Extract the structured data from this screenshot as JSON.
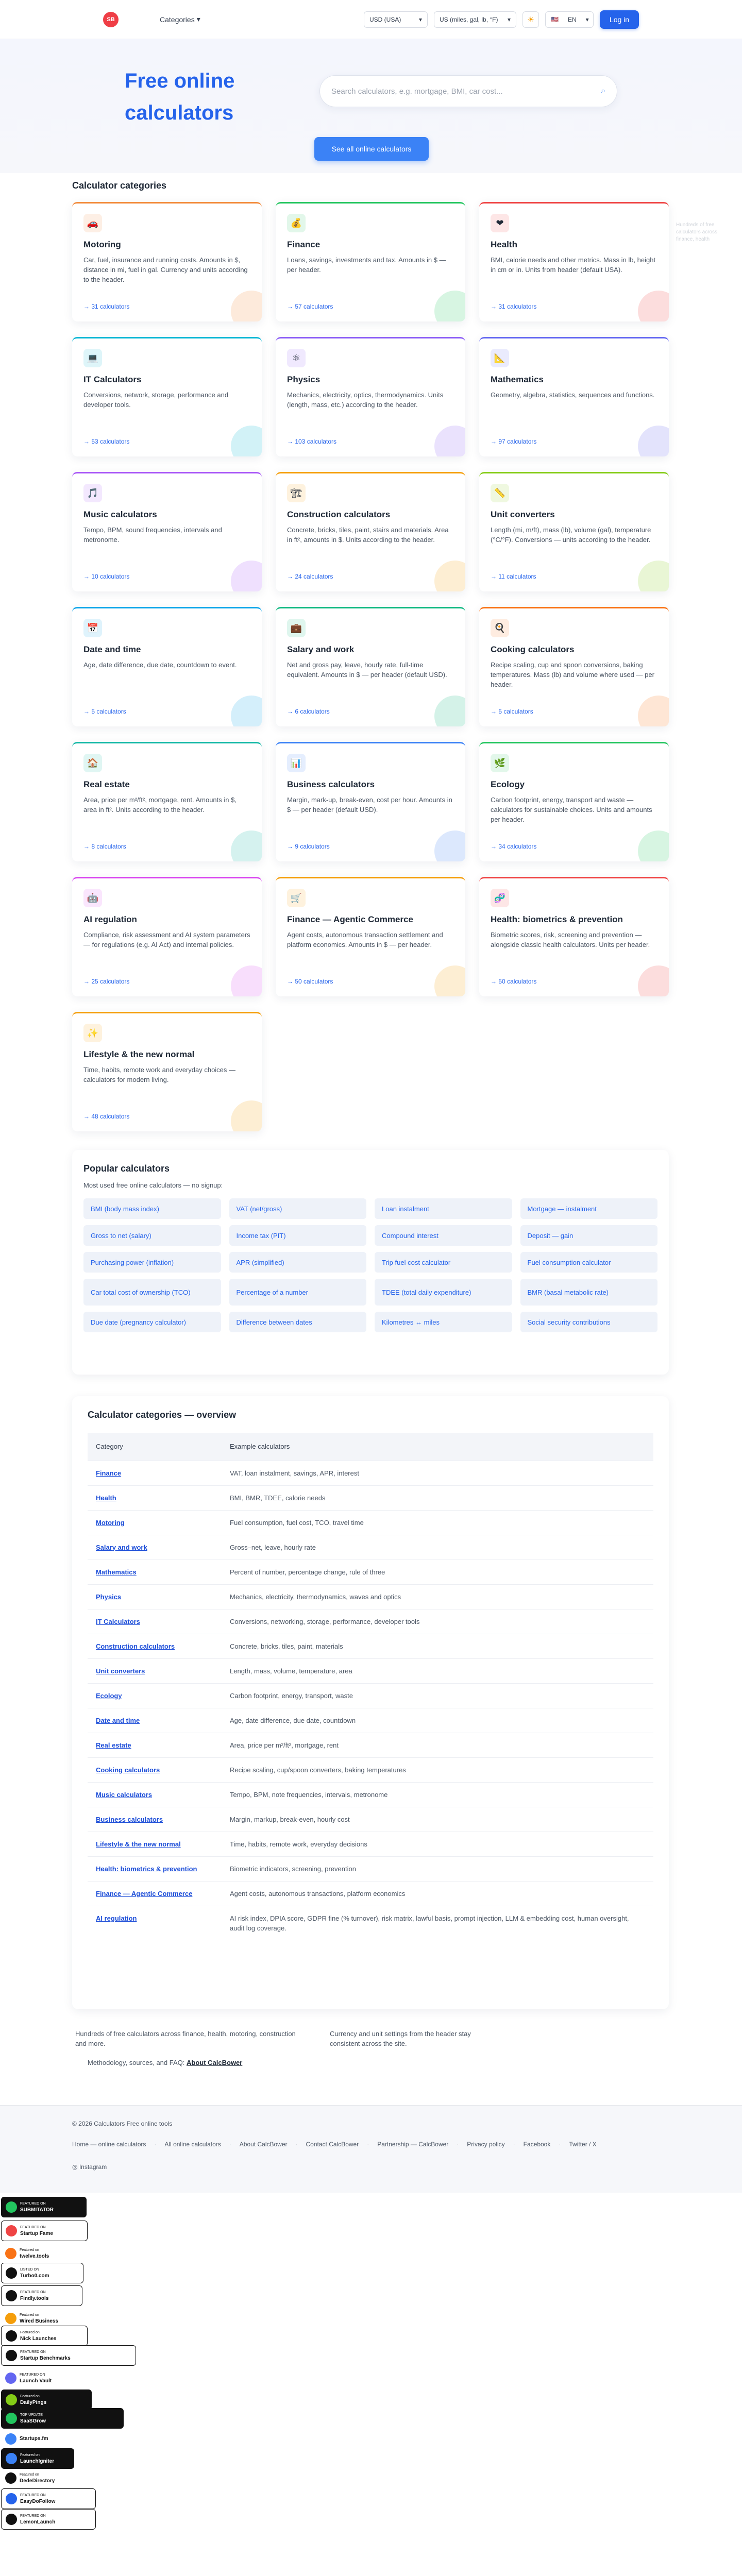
{
  "header": {
    "logo_text": "SB",
    "categories_menu": "Categories",
    "currency": "USD (USA)",
    "units": "US (miles, gal, lb, °F)",
    "language": "EN",
    "language_flag": "🇺🇸",
    "login": "Log in"
  },
  "hero": {
    "title": "Free online calculators",
    "search_placeholder": "Search calculators, e.g. mortgage, BMI, car cost...",
    "see_all": "See all online calculators"
  },
  "categories_title": "Calculator categories",
  "categories": [
    {
      "name": "Motoring",
      "icon": "car-icon",
      "glyph": "🚗",
      "color": "#f28a3a",
      "desc": "Car, fuel, insurance and running costs. Amounts in $, distance in mi, fuel in gal. Currency and units according to the header.",
      "count": "→ 31 calculators"
    },
    {
      "name": "Finance",
      "icon": "money-bag-icon",
      "glyph": "💰",
      "color": "#22c55e",
      "desc": "Loans, savings, investments and tax. Amounts in $ — per header.",
      "count": "→ 57 calculators"
    },
    {
      "name": "Health",
      "icon": "heart-icon",
      "glyph": "❤",
      "color": "#ef4444",
      "desc": "BMI, calorie needs and other metrics. Mass in lb, height in cm or in. Units from header (default USA).",
      "count": "→ 31 calculators"
    },
    {
      "name": "IT Calculators",
      "icon": "laptop-icon",
      "glyph": "💻",
      "color": "#06b6d4",
      "desc": "Conversions, network, storage, performance and developer tools.",
      "count": "→ 53 calculators"
    },
    {
      "name": "Physics",
      "icon": "atom-icon",
      "glyph": "⚛",
      "color": "#8b5cf6",
      "desc": "Mechanics, electricity, optics, thermodynamics. Units (length, mass, etc.) according to the header.",
      "count": "→ 103 calculators"
    },
    {
      "name": "Mathematics",
      "icon": "ruler-icon",
      "glyph": "📐",
      "color": "#6366f1",
      "desc": "Geometry, algebra, statistics, sequences and functions.",
      "count": "→ 97 calculators"
    },
    {
      "name": "Music calculators",
      "icon": "music-note-icon",
      "glyph": "🎵",
      "color": "#a855f7",
      "desc": "Tempo, BPM, sound frequencies, intervals and metronome.",
      "count": "→ 10 calculators"
    },
    {
      "name": "Construction calculators",
      "icon": "building-icon",
      "glyph": "🏗",
      "color": "#f59e0b",
      "desc": "Concrete, bricks, tiles, paint, stairs and materials. Area in ft², amounts in $. Units according to the header.",
      "count": "→ 24 calculators"
    },
    {
      "name": "Unit converters",
      "icon": "ruler-straight-icon",
      "glyph": "📏",
      "color": "#84cc16",
      "desc": "Length (mi, m/ft), mass (lb), volume (gal), temperature (°C/°F). Conversions — units according to the header.",
      "count": "→ 11 calculators"
    },
    {
      "name": "Date and time",
      "icon": "calendar-icon",
      "glyph": "📅",
      "color": "#0ea5e9",
      "desc": "Age, date difference, due date, countdown to event.",
      "count": "→ 5 calculators"
    },
    {
      "name": "Salary and work",
      "icon": "briefcase-icon",
      "glyph": "💼",
      "color": "#10b981",
      "desc": "Net and gross pay, leave, hourly rate, full-time equivalent. Amounts in $ — per header (default USD).",
      "count": "→ 6 calculators"
    },
    {
      "name": "Cooking calculators",
      "icon": "cooking-icon",
      "glyph": "🍳",
      "color": "#f97316",
      "desc": "Recipe scaling, cup and spoon conversions, baking temperatures. Mass (lb) and volume where used — per header.",
      "count": "→ 5 calculators"
    },
    {
      "name": "Real estate",
      "icon": "house-icon",
      "glyph": "🏠",
      "color": "#14b8a6",
      "desc": "Area, price per m²/ft², mortgage, rent. Amounts in $, area in ft². Units according to the header.",
      "count": "→ 8 calculators"
    },
    {
      "name": "Business calculators",
      "icon": "chart-icon",
      "glyph": "📊",
      "color": "#3b82f6",
      "desc": "Margin, mark-up, break-even, cost per hour. Amounts in $ — per header (default USD).",
      "count": "→ 9 calculators"
    },
    {
      "name": "Ecology",
      "icon": "leaf-icon",
      "glyph": "🌿",
      "color": "#22c55e",
      "desc": "Carbon footprint, energy, transport and waste — calculators for sustainable choices. Units and amounts per header.",
      "count": "→ 34 calculators"
    },
    {
      "name": "AI regulation",
      "icon": "robot-icon",
      "glyph": "🤖",
      "color": "#d946ef",
      "desc": "Compliance, risk assessment and AI system parameters — for regulations (e.g. AI Act) and internal policies.",
      "count": "→ 25 calculators"
    },
    {
      "name": "Finance — Agentic Commerce",
      "icon": "shopping-cart-icon",
      "glyph": "🛒",
      "color": "#f59e0b",
      "desc": "Agent costs, autonomous transaction settlement and platform economics. Amounts in $ — per header.",
      "count": "→ 50 calculators"
    },
    {
      "name": "Health: biometrics & prevention",
      "icon": "dna-icon",
      "glyph": "🧬",
      "color": "#ef4444",
      "desc": "Biometric scores, risk, screening and prevention — alongside classic health calculators. Units per header.",
      "count": "→ 50 calculators"
    },
    {
      "name": "Lifestyle & the new normal",
      "icon": "sparkle-icon",
      "glyph": "✨",
      "color": "#f59e0b",
      "desc": "Time, habits, remote work and everyday choices — calculators for modern living.",
      "count": "→ 48 calculators"
    }
  ],
  "ghost_text": "Hundreds of free calculators across finance, health",
  "popular": {
    "title": "Popular calculators",
    "subtitle": "Most used free online calculators — no signup:",
    "items": [
      "BMI (body mass index)",
      "VAT (net/gross)",
      "Loan instalment",
      "Mortgage — instalment",
      "Gross to net (salary)",
      "Income tax (PIT)",
      "Compound interest",
      "Deposit — gain",
      "Purchasing power (inflation)",
      "APR (simplified)",
      "Trip fuel cost calculator",
      "Fuel consumption calculator",
      "Car total cost of ownership (TCO)",
      "Percentage of a number",
      "TDEE (total daily expenditure)",
      "BMR (basal metabolic rate)",
      "Due date (pregnancy calculator)",
      "Difference between dates",
      "Kilometres ↔ miles",
      "Social security contributions"
    ]
  },
  "overview": {
    "title": "Calculator categories — overview",
    "col_category": "Category",
    "col_examples": "Example calculators",
    "rows": [
      {
        "cat": "Finance",
        "ex": "VAT, loan instalment, savings, APR, interest"
      },
      {
        "cat": "Health",
        "ex": "BMI, BMR, TDEE, calorie needs"
      },
      {
        "cat": "Motoring",
        "ex": "Fuel consumption, fuel cost, TCO, travel time"
      },
      {
        "cat": "Salary and work",
        "ex": "Gross–net, leave, hourly rate"
      },
      {
        "cat": "Mathematics",
        "ex": "Percent of number, percentage change, rule of three"
      },
      {
        "cat": "Physics",
        "ex": "Mechanics, electricity, thermodynamics, waves and optics"
      },
      {
        "cat": "IT Calculators",
        "ex": "Conversions, networking, storage, performance, developer tools"
      },
      {
        "cat": "Construction calculators",
        "ex": "Concrete, bricks, tiles, paint, materials"
      },
      {
        "cat": "Unit converters",
        "ex": "Length, mass, volume, temperature, area"
      },
      {
        "cat": "Ecology",
        "ex": "Carbon footprint, energy, transport, waste"
      },
      {
        "cat": "Date and time",
        "ex": "Age, date difference, due date, countdown"
      },
      {
        "cat": "Real estate",
        "ex": "Area, price per m²/ft², mortgage, rent"
      },
      {
        "cat": "Cooking calculators",
        "ex": "Recipe scaling, cup/spoon converters, baking temperatures"
      },
      {
        "cat": "Music calculators",
        "ex": "Tempo, BPM, note frequencies, intervals, metronome"
      },
      {
        "cat": "Business calculators",
        "ex": "Margin, markup, break-even, hourly cost"
      },
      {
        "cat": "Lifestyle & the new normal",
        "ex": "Time, habits, remote work, everyday decisions"
      },
      {
        "cat": "Health: biometrics & prevention",
        "ex": "Biometric indicators, screening, prevention"
      },
      {
        "cat": "Finance — Agentic Commerce",
        "ex": "Agent costs, autonomous transactions, platform economics"
      },
      {
        "cat": "AI regulation",
        "ex": "AI risk index, DPIA score, GDPR fine (% turnover), risk matrix, lawful basis, prompt injection, LLM & embedding cost, human oversight, audit log coverage."
      }
    ]
  },
  "notes": {
    "left": "Hundreds of free calculators across finance, health, motoring, construction and more.",
    "right": "Currency and unit settings from the header stay consistent across the site.",
    "methodology_prefix": "Methodology, sources, and FAQ:",
    "methodology_link": "About CalcBower"
  },
  "footer": {
    "copyright": "© 2026 Calculators Free online tools",
    "links": [
      "Home — online calculators",
      "All online calculators",
      "About CalcBower",
      "Contact CalcBower",
      "Partnership — CalcBower",
      "Privacy policy",
      "Facebook",
      "Twitter / X"
    ],
    "instagram": "Instagram"
  },
  "badges": [
    {
      "top": "FEATURED ON",
      "name": "SUBMITATOR",
      "style": "dark",
      "icon": "submitator-icon",
      "color": "#22c55e"
    },
    {
      "top": "FEATURED ON",
      "name": "Startup Fame",
      "style": "light",
      "icon": "startup-fame-icon",
      "color": "#ef4444"
    },
    {
      "top": "Featured on",
      "name": "twelve.tools",
      "style": "plain",
      "icon": "twelve-tools-icon",
      "color": "#f97316"
    },
    {
      "top": "LISTED ON",
      "name": "Turbo0.com",
      "style": "light",
      "icon": "turbo0-icon",
      "color": "#111111"
    },
    {
      "top": "FEATURED ON",
      "name": "Findly.tools",
      "style": "light",
      "icon": "findly-icon",
      "color": "#111111"
    },
    {
      "top": "Featured on",
      "name": "Wired Business",
      "style": "plain",
      "icon": "wired-business-icon",
      "color": "#f59e0b"
    },
    {
      "top": "Featured on",
      "name": "Nick Launches",
      "style": "light",
      "icon": "nick-launches-icon",
      "color": "#111111"
    },
    {
      "top": "FEATURED ON",
      "name": "Startup Benchmarks",
      "style": "light",
      "icon": "startup-benchmarks-icon",
      "color": "#111111"
    },
    {
      "top": "FEATURED ON",
      "name": "Launch Vault",
      "style": "plain",
      "icon": "launch-vault-icon",
      "color": "#6366f1"
    },
    {
      "top": "Featured on",
      "name": "DailyPings",
      "style": "dark",
      "icon": "dailypings-icon",
      "color": "#84cc16"
    },
    {
      "top": "TOP UPDATE",
      "name": "SaaSGrow",
      "style": "dark",
      "icon": "saasgrow-icon",
      "color": "#22c55e"
    },
    {
      "top": "",
      "name": "Startups.fm",
      "style": "plain",
      "icon": "startups-fm-icon",
      "color": "#3b82f6"
    },
    {
      "top": "Featured on",
      "name": "LaunchIgniter",
      "style": "dark",
      "icon": "launchigniter-icon",
      "color": "#3b82f6"
    },
    {
      "top": "Featured on",
      "name": "DedeDirectory",
      "style": "plain",
      "icon": "dededirectory-icon",
      "color": "#111111"
    },
    {
      "top": "FEATURED ON",
      "name": "EasyDoFollow",
      "style": "light",
      "icon": "easydofollow-icon",
      "color": "#2563eb"
    },
    {
      "top": "FEATURED ON",
      "name": "LemonLaunch",
      "style": "light",
      "icon": "lemonlaunch-icon",
      "color": "#111111"
    }
  ]
}
